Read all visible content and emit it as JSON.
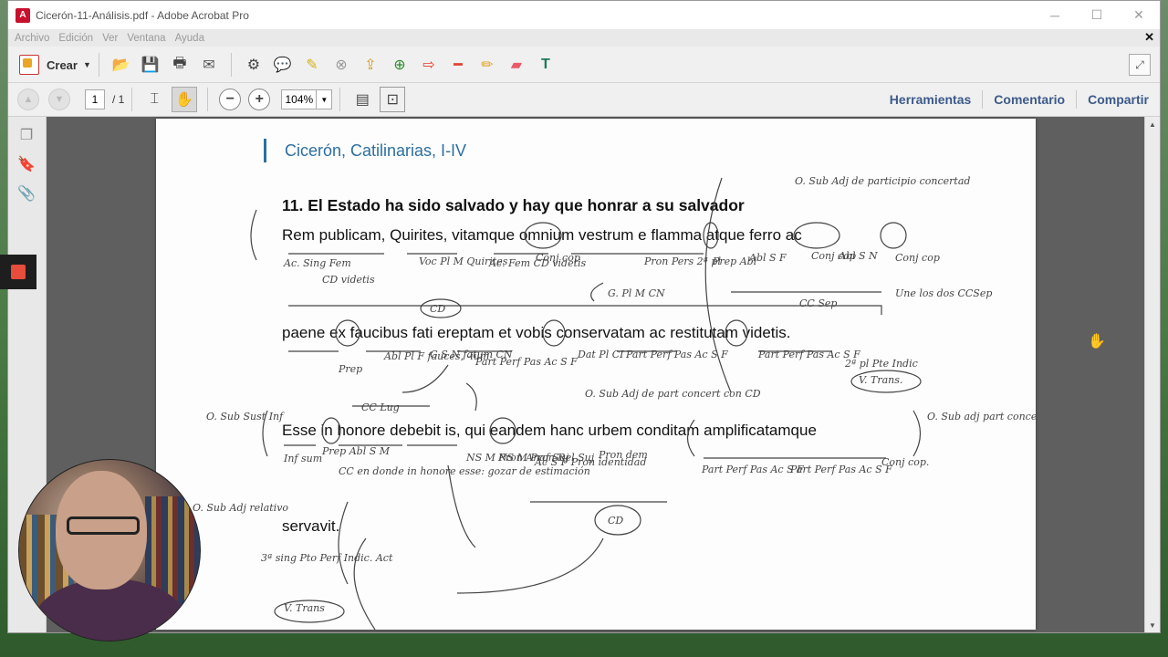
{
  "window": {
    "title": "Cicerón-11-Análisis.pdf - Adobe Acrobat Pro",
    "controls": [
      "─",
      "☐",
      "✕"
    ]
  },
  "menu": [
    "Archivo",
    "Edición",
    "Ver",
    "Ventana",
    "Ayuda"
  ],
  "toolbar": {
    "crear_label": "Crear",
    "tools": [
      "gear",
      "comment",
      "highlight",
      "stamp",
      "export",
      "attach",
      "arrow",
      "line",
      "pencil",
      "eraser",
      "text"
    ]
  },
  "navbar": {
    "page_current": "1",
    "page_total": "/ 1",
    "zoom": "104%",
    "links": [
      "Herramientas",
      "Comentario",
      "Compartir"
    ]
  },
  "document": {
    "header": "Cicerón, Catilinarias, I-IV",
    "heading": "11. El Estado ha sido salvado y hay que honrar a su salvador",
    "lines": [
      "Rem publicam, Quirites, vitamque omnium vestrum e flamma atque ferro ac",
      "paene ex faucibus fati ereptam et vobis conservatam ac restitutam videtis.",
      "Esse in honore debebit is, qui eandem hanc urbem conditam amplificatamque",
      "servavit."
    ],
    "annotations": [
      "O. Sub Adj de participio concertad",
      "Ac. Sing Fem",
      "CD videtis",
      "Voc Pl M Quirites",
      "Ac. Fem CD videtis",
      "Conj cop",
      "Pron Pers 2ª pl",
      "Prep Abl",
      "Abl S F",
      "Conj cop",
      "Abl S N",
      "Conj cop",
      "Une los dos CCSep",
      "CD",
      "G. Pl M CN",
      "CC Sep",
      "Prep",
      "Abl Pl F fauces, -ium",
      "G S N fatum CN",
      "Part Perf Pas Ac S F",
      "Dat Pl CI",
      "Part Perf Pas Ac S F",
      "Part Perf Pas Ac S F",
      "2ª pl Pte Indic",
      "V. Trans.",
      "O. Sub Adj de part concert con CD",
      "O. Sub Sust Inf",
      "Prep Abl S M",
      "CC Lug",
      "CC en donde in honore esse: gozar de estimación",
      "Inf sum",
      "NS M Pron Anaf Suj",
      "NS M Pron Rel Suj",
      "Ac S F Pron identidad",
      "Pron dem",
      "CD",
      "Part Perf Pas Ac S F",
      "Part Perf Pas Ac S F",
      "Conj cop.",
      "O. Sub adj part concert con CD",
      "O. Sub Adj relativo",
      "3ª sing Pto Perf Indic. Act",
      "V. Trans"
    ]
  },
  "webcam_label": "webcam"
}
